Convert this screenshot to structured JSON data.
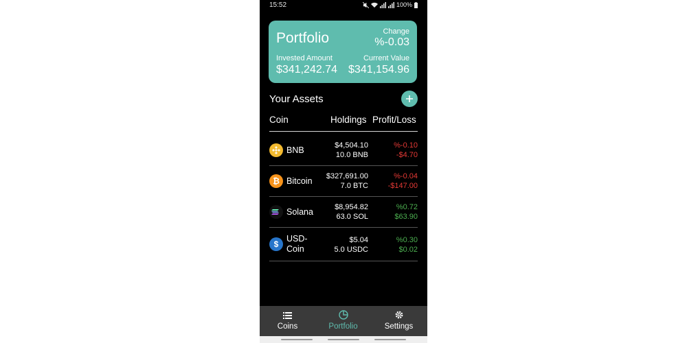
{
  "status": {
    "time": "15:52",
    "battery": "100%",
    "icons": [
      "mute-icon",
      "wifi-icon",
      "signal-icon",
      "signal-icon",
      "battery-icon"
    ]
  },
  "portfolio": {
    "title": "Portfolio",
    "change_label": "Change",
    "change_value": "%-0.03",
    "invested_label": "Invested Amount",
    "invested_value": "$341,242.74",
    "current_label": "Current Value",
    "current_value": "$341,154.96",
    "accent": "#5fbcae"
  },
  "assets": {
    "title": "Your Assets",
    "add_icon": "plus-icon",
    "columns": [
      "Coin",
      "Holdings",
      "Profit/Loss"
    ],
    "rows": [
      {
        "name": "BNB",
        "name2": "",
        "icon": "bnb-icon",
        "value": "$4,504.10",
        "amount": "10.0 BNB",
        "pct": "%-0.10",
        "pl": "-$4.70",
        "trend": "down"
      },
      {
        "name": "Bitcoin",
        "name2": "",
        "icon": "bitcoin-icon",
        "value": "$327,691.00",
        "amount": "7.0 BTC",
        "pct": "%-0.04",
        "pl": "-$147.00",
        "trend": "down"
      },
      {
        "name": "Solana",
        "name2": "",
        "icon": "solana-icon",
        "value": "$8,954.82",
        "amount": "63.0 SOL",
        "pct": "%0.72",
        "pl": "$63.90",
        "trend": "up"
      },
      {
        "name": "USD-",
        "name2": "Coin",
        "icon": "usd-coin-icon",
        "value": "$5.04",
        "amount": "5.0 USDC",
        "pct": "%0.30",
        "pl": "$0.02",
        "trend": "up"
      }
    ],
    "colors": {
      "down": "#e53935",
      "up": "#4caf50"
    }
  },
  "nav": {
    "items": [
      {
        "label": "Coins",
        "icon": "list-icon",
        "active": false
      },
      {
        "label": "Portfolio",
        "icon": "pie-chart-icon",
        "active": true
      },
      {
        "label": "Settings",
        "icon": "gear-icon",
        "active": false
      }
    ],
    "active_color": "#5fbcae"
  }
}
